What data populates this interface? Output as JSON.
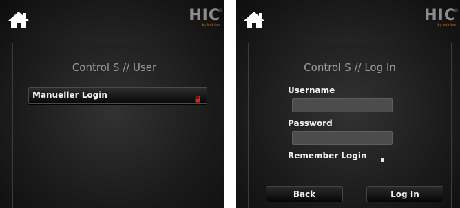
{
  "brand": {
    "logo": "HIC",
    "sub": "by bob:tec",
    "reg": "®"
  },
  "user_screen": {
    "title": "Control S // User",
    "manual_login_label": "Manueller Login",
    "lock_icon": "lock-icon",
    "lock_color": "#cc2a2a"
  },
  "login_screen": {
    "title": "Control S // Log In",
    "username_label": "Username",
    "username_value": "",
    "password_label": "Password",
    "password_value": "",
    "remember_label": "Remember Login",
    "back_label": "Back",
    "login_label": "Log In"
  },
  "icons": {
    "home": "home-icon"
  }
}
